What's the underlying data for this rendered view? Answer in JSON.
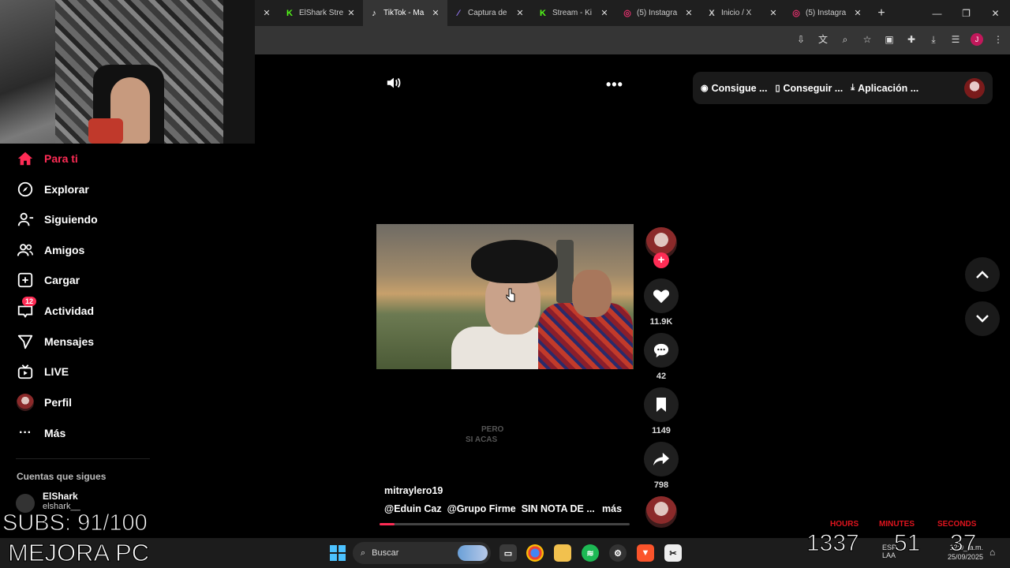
{
  "browser": {
    "tabs": [
      {
        "label": "ElShark Stre",
        "icon": "kick-icon",
        "color": "#53fc18",
        "active": false
      },
      {
        "label": "TikTok - Ma",
        "icon": "tiktok-icon",
        "color": "#ffffff",
        "active": true
      },
      {
        "label": "Captura de",
        "icon": "feather-icon",
        "color": "#9b7bff",
        "active": false
      },
      {
        "label": "Stream - Ki",
        "icon": "kick-icon",
        "color": "#53fc18",
        "active": false
      },
      {
        "label": "(5) Instagra",
        "icon": "instagram-icon",
        "color": "#e1306c",
        "active": false
      },
      {
        "label": "Inicio / X",
        "icon": "x-icon",
        "color": "#ffffff",
        "active": false
      },
      {
        "label": "(5) Instagra",
        "icon": "instagram-icon",
        "color": "#e1306c",
        "active": false
      }
    ],
    "profile_initial": "J"
  },
  "sidebar": {
    "items": [
      {
        "label": "Para ti",
        "icon": "home-icon",
        "active": true
      },
      {
        "label": "Explorar",
        "icon": "compass-icon",
        "active": false
      },
      {
        "label": "Siguiendo",
        "icon": "user-follow-icon",
        "active": false
      },
      {
        "label": "Amigos",
        "icon": "friends-icon",
        "active": false
      },
      {
        "label": "Cargar",
        "icon": "upload-plus-icon",
        "active": false
      },
      {
        "label": "Actividad",
        "icon": "inbox-icon",
        "active": false,
        "badge": "12"
      },
      {
        "label": "Mensajes",
        "icon": "send-icon",
        "active": false
      },
      {
        "label": "LIVE",
        "icon": "live-tv-icon",
        "active": false
      },
      {
        "label": "Perfil",
        "icon": "profile-avatar",
        "active": false
      },
      {
        "label": "Más",
        "icon": "more-dots-icon",
        "active": false
      }
    ],
    "following_title": "Cuentas que sigues",
    "following": [
      {
        "name": "ElShark",
        "handle": "elshark__"
      }
    ]
  },
  "topbar": {
    "pills": [
      {
        "label": "Consigue ...",
        "icon": "coin-icon"
      },
      {
        "label": "Conseguir ...",
        "icon": "phone-icon"
      },
      {
        "label": "Aplicación ...",
        "icon": "download-icon"
      }
    ]
  },
  "video": {
    "author": "mitraylero19",
    "mentions": [
      "@Eduin Caz",
      "@Grupo Firme"
    ],
    "description": "SIN NOTA DE ...",
    "more_label": "más",
    "overlay_lines": [
      "PERO",
      "SI ACAS"
    ],
    "progress": 0.06,
    "likes": "11.9K",
    "comments": "42",
    "saves": "1149",
    "shares": "798"
  },
  "overlay": {
    "subs": "SUBS: 91/100",
    "mejora": "MEJORA PC",
    "timer": {
      "hours_label": "HOURS",
      "minutes_label": "MINUTES",
      "seconds_label": "SECONDS",
      "hours": "1337",
      "minutes": "51",
      "seconds": "37"
    }
  },
  "taskbar": {
    "search_label": "Buscar",
    "lang1": "ESP",
    "lang2": "LAA",
    "time": "12:0_ a.m.",
    "date": "25/09/2025"
  }
}
